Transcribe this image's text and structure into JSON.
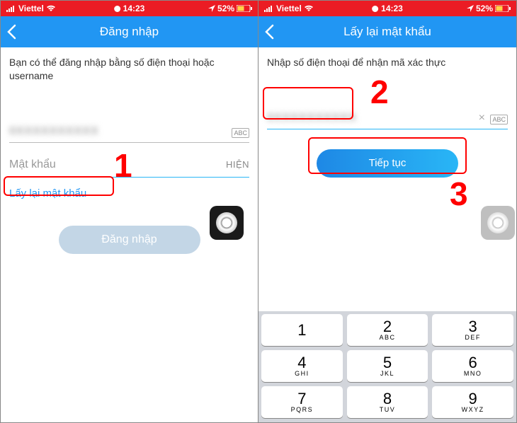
{
  "status": {
    "carrier": "Viettel",
    "time": "14:23",
    "battery": "52%"
  },
  "left": {
    "title": "Đăng nhập",
    "instruction": "Bạn có thể đăng nhập bằng số điện thoại hoặc username",
    "phone_masked": "0XXXXXXXXXX",
    "abc": "ABC",
    "password_placeholder": "Mật khẩu",
    "show_label": "HIỆN",
    "forgot_label": "Lấy lại mật khẩu",
    "login_label": "Đăng nhập"
  },
  "right": {
    "title": "Lấy lại mật khẩu",
    "instruction": "Nhập số điện thoại để nhận mã xác thực",
    "phone_masked": "0XXXXXXXXXX",
    "abc": "ABC",
    "continue_label": "Tiếp tục"
  },
  "annotations": {
    "n1": "1",
    "n2": "2",
    "n3": "3"
  },
  "keypad": {
    "keys": [
      [
        {
          "d": "1",
          "l": ""
        },
        {
          "d": "2",
          "l": "ABC"
        },
        {
          "d": "3",
          "l": "DEF"
        }
      ],
      [
        {
          "d": "4",
          "l": "GHI"
        },
        {
          "d": "5",
          "l": "JKL"
        },
        {
          "d": "6",
          "l": "MNO"
        }
      ],
      [
        {
          "d": "7",
          "l": "PQRS"
        },
        {
          "d": "8",
          "l": "TUV"
        },
        {
          "d": "9",
          "l": "WXYZ"
        }
      ]
    ]
  }
}
